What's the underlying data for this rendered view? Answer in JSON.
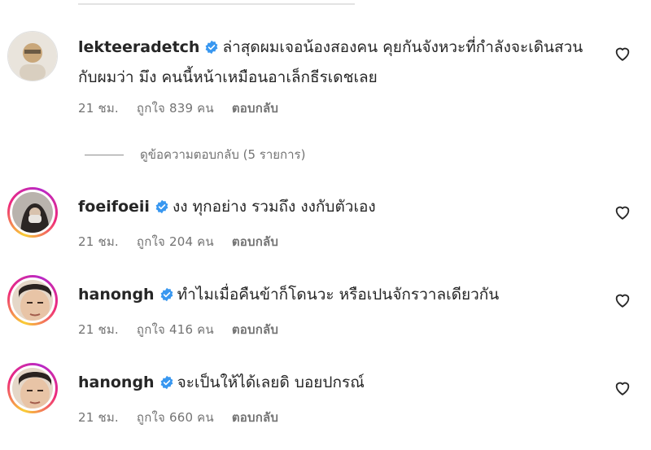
{
  "comments": [
    {
      "username": "lekteeradetch",
      "text": "ล่าสุดผมเจอน้องสองคน คุยกันจังหวะที่กำลังจะเดินสวนกับผมว่า มึง คนนี้หน้าเหมือนอาเล็กธีรเดชเลย",
      "time": "21 ชม.",
      "likes": "ถูกใจ 839 คน",
      "reply_label": "ตอบกลับ"
    },
    {
      "username": "foeifoeii",
      "text": "งง ทุกอย่าง รวมถึง งงกับตัวเอง",
      "time": "21 ชม.",
      "likes": "ถูกใจ 204 คน",
      "reply_label": "ตอบกลับ"
    },
    {
      "username": "hanongh",
      "text": "ทำไมเมื่อคืนข้าก็โดนวะ หรือเปนจักรวาลเดียวกัน",
      "time": "21 ชม.",
      "likes": "ถูกใจ 416 คน",
      "reply_label": "ตอบกลับ"
    },
    {
      "username": "hanongh",
      "text": "จะเป็นให้ได้เลยดิ บอยปกรณ์",
      "time": "21 ชม.",
      "likes": "ถูกใจ 660 คน",
      "reply_label": "ตอบกลับ"
    }
  ],
  "view_replies": "ดูข้อความตอบกลับ (5 รายการ)",
  "colors": {
    "verified": "#3897f0",
    "meta": "#737373",
    "text": "#262626"
  },
  "icons": {
    "verified": "verified-badge-icon",
    "like": "heart-outline-icon"
  }
}
